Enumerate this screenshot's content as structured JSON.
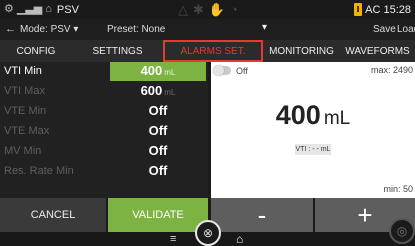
{
  "status": {
    "title": "PSV",
    "ac_label": "AC 15:28",
    "icons": [
      "settings-icon",
      "bars-icon",
      "house-icon",
      "fan-icon",
      "hand-icon",
      "bell-icon"
    ]
  },
  "modebar": {
    "mode": "Mode: PSV ▾",
    "preset": "Preset: None",
    "save": "Save",
    "load": "Load"
  },
  "tabs": [
    {
      "label": "CONFIG"
    },
    {
      "label": "SETTINGS"
    },
    {
      "label": "ALARMS SET."
    },
    {
      "label": "MONITORING"
    },
    {
      "label": "WAVEFORMS"
    }
  ],
  "alarms": [
    {
      "name": "VTI Min",
      "value": "400",
      "unit": "mL"
    },
    {
      "name": "VTI Max",
      "value": "600",
      "unit": "mL"
    },
    {
      "name": "VTE Min",
      "value": "Off",
      "unit": ""
    },
    {
      "name": "VTE Max",
      "value": "Off",
      "unit": ""
    },
    {
      "name": "MV Min",
      "value": "Off",
      "unit": ""
    },
    {
      "name": "Res. Rate Min",
      "value": "Off",
      "unit": ""
    }
  ],
  "panel": {
    "toggle_label": "Off",
    "max_label": "max: 2490",
    "big_value": "400",
    "big_unit": "mL",
    "vti_chip": "VTI : - - mL",
    "min_label": "min: 50"
  },
  "buttons": {
    "cancel": "CANCEL",
    "validate": "VALIDATE",
    "minus": "-",
    "plus": "+"
  },
  "colors": {
    "accent_green": "#7cb342",
    "tab_highlight": "#e53935",
    "battery": "#f0b400"
  }
}
